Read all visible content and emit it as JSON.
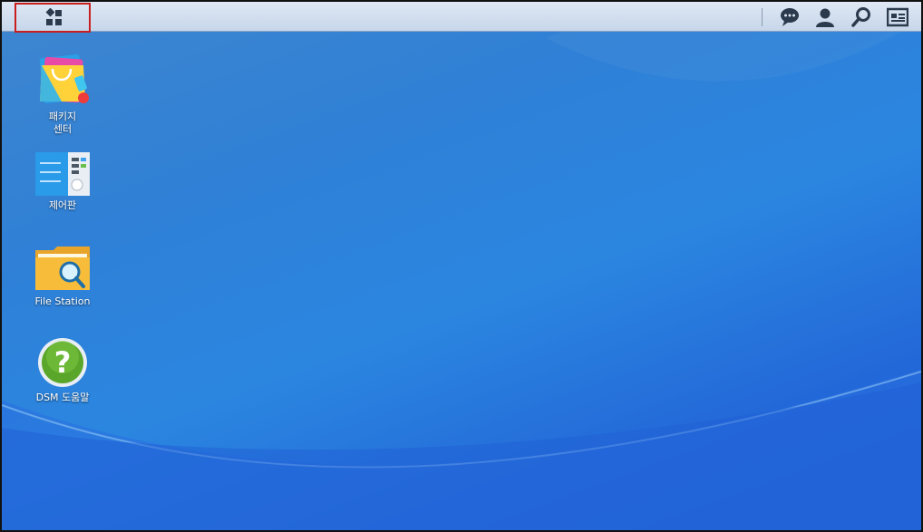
{
  "taskbar": {
    "main_menu_icon": "main-menu-icon",
    "right_icons": [
      "notification-icon",
      "user-icon",
      "search-icon",
      "widgets-icon"
    ]
  },
  "desktop": {
    "items": [
      {
        "label": "패키지\n센터",
        "icon": "package-center-icon"
      },
      {
        "label": "제어판",
        "icon": "control-panel-icon"
      },
      {
        "label": "File Station",
        "icon": "file-station-icon"
      },
      {
        "label": "DSM 도움말",
        "icon": "dsm-help-icon"
      }
    ]
  },
  "colors": {
    "accent_highlight": "#c81e1e",
    "desktop_blue": "#2b86e0"
  }
}
